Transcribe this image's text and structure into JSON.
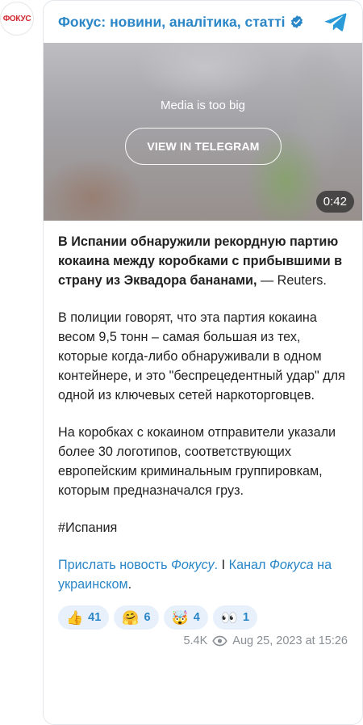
{
  "channel": {
    "avatar_text": "ФОКУС",
    "title": "Фокус: новини, аналітика, статті"
  },
  "media": {
    "note": "Media is too big",
    "button": "VIEW IN TELEGRAM",
    "duration": "0:42"
  },
  "post": {
    "lead_bold": "В Испании обнаружили рекордную партию кокаина между коробками с прибывшими в страну из Эквадора бананами,",
    "lead_rest": " — Reuters.",
    "para2": "В полиции говорят, что эта партия кокаина весом 9,5 тонн – самая большая из тех, которые когда-либо обнаруживали в одном контейнере, и это \"беспрецедентный удар\" для одной из ключевых сетей наркоторговцев.",
    "para3": "На коробках с кокаином отправители указали более 30 логотипов, соответствующих европейским криминальным группировкам, которым предназначался груз.",
    "hashtag": "#Испания",
    "link1_pre": "Прислать новость ",
    "link1_italic": "Фокусу",
    "link1_post": ".",
    "separator": " I ",
    "link2_pre": "Канал ",
    "link2_italic": "Фокуса",
    "link2_post": " на украинском",
    "end_dot": "."
  },
  "reactions": [
    {
      "emoji": "👍",
      "count": "41"
    },
    {
      "emoji": "🤗",
      "count": "6"
    },
    {
      "emoji": "🤯",
      "count": "4"
    },
    {
      "emoji": "👀",
      "count": "1"
    }
  ],
  "footer": {
    "views": "5.4K",
    "date": "Aug 25, 2023 at 15:26"
  },
  "colors": {
    "accent": "#2a86c7",
    "brand_red": "#d0262d",
    "meta": "#8a8f95",
    "reaction_bg": "#e8f1fb"
  }
}
